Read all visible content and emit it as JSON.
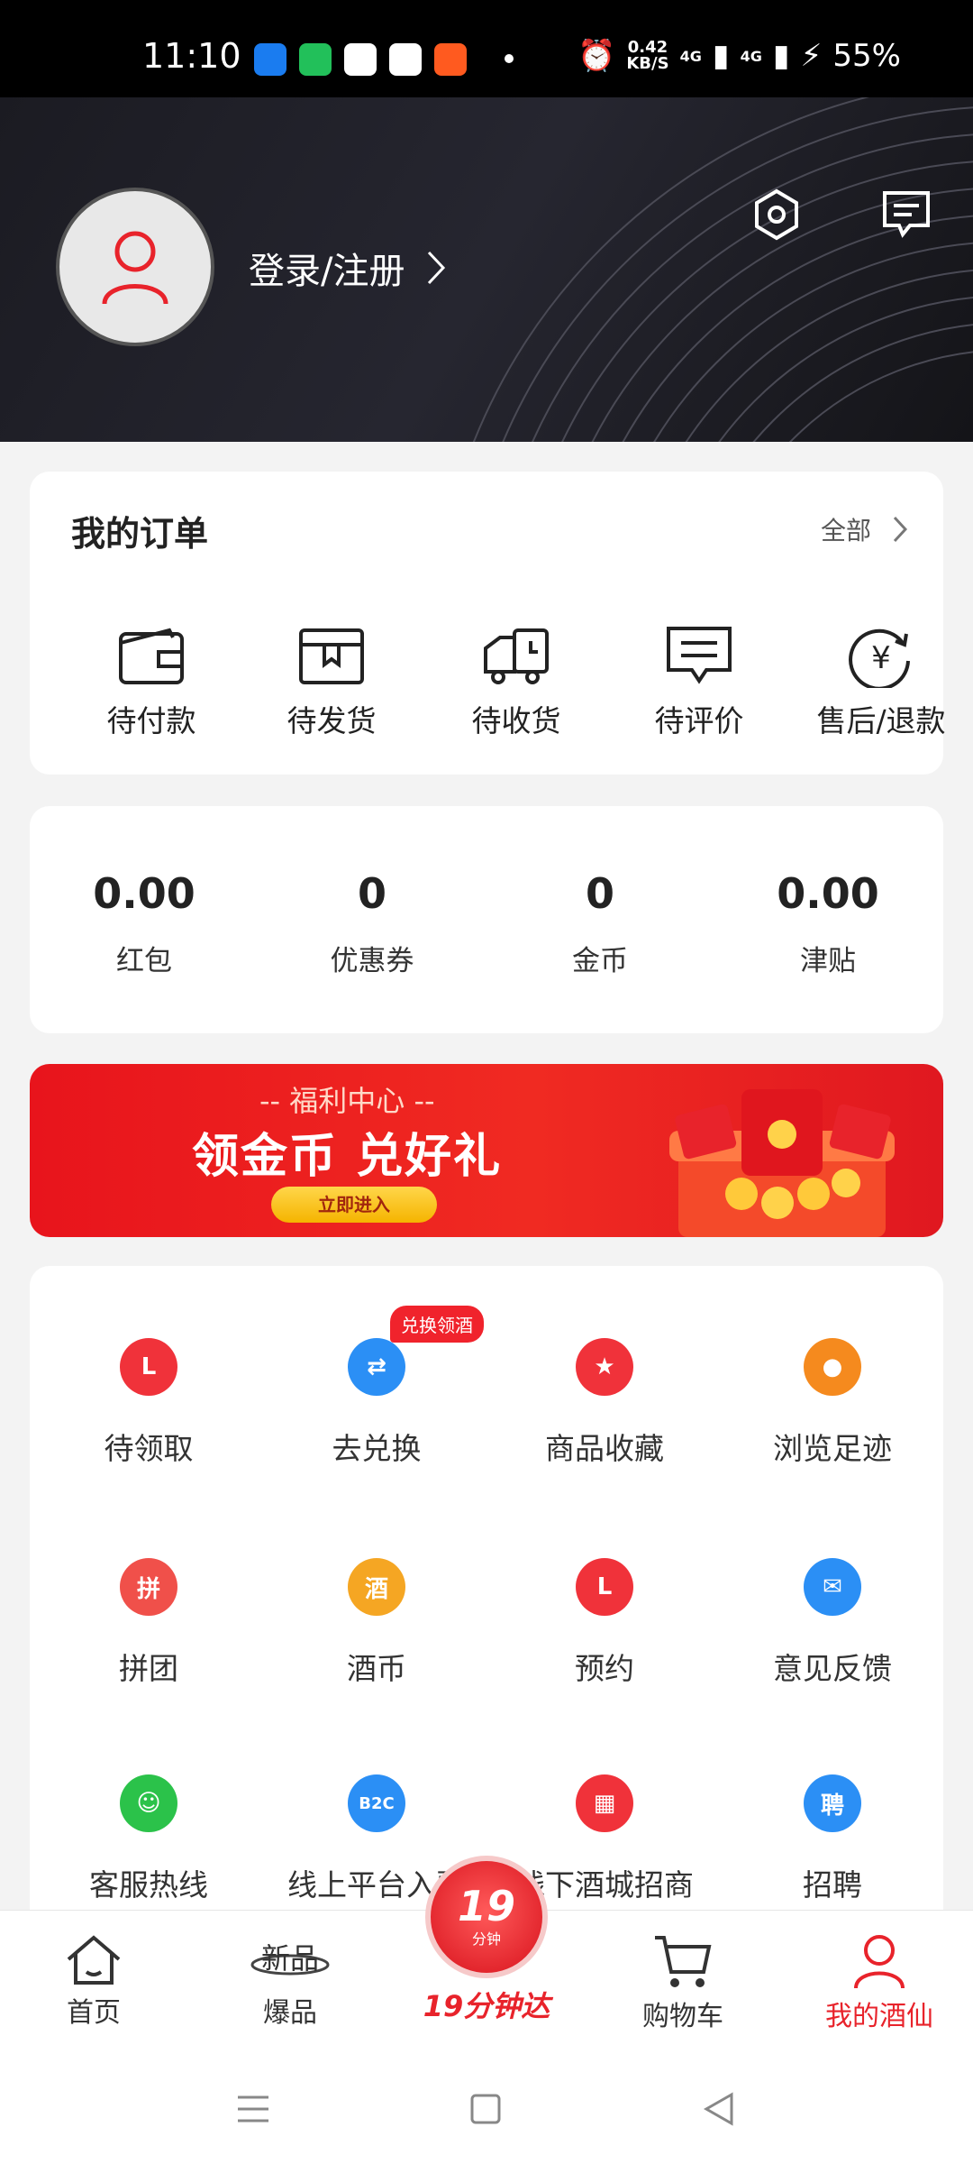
{
  "status_bar": {
    "time": "11:10",
    "speed_value": "0.42",
    "speed_unit": "KB/S",
    "net1": "4G",
    "net2": "4G",
    "battery": "55%"
  },
  "header": {
    "login_label": "登录/注册"
  },
  "orders": {
    "title": "我的订单",
    "all_label": "全部",
    "items": [
      {
        "label": "待付款",
        "icon": "wallet-icon"
      },
      {
        "label": "待发货",
        "icon": "box-icon"
      },
      {
        "label": "待收货",
        "icon": "truck-icon"
      },
      {
        "label": "待评价",
        "icon": "comment-icon"
      },
      {
        "label": "售后/退款",
        "icon": "refund-icon"
      }
    ]
  },
  "wallet": {
    "items": [
      {
        "value": "0.00",
        "label": "红包"
      },
      {
        "value": "0",
        "label": "优惠券"
      },
      {
        "value": "0",
        "label": "金币"
      },
      {
        "value": "0.00",
        "label": "津贴"
      }
    ]
  },
  "banner": {
    "subtitle": "-- 福利中心 --",
    "title": "领金币 兑好礼",
    "button": "立即进入"
  },
  "tools": {
    "badge": "兑换领酒",
    "items": [
      {
        "label": "待领取",
        "icon": "gift-box-icon",
        "glyph": "L",
        "color": "#f0323a"
      },
      {
        "label": "去兑换",
        "icon": "exchange-icon",
        "glyph": "⇄",
        "color": "#2b8ff5"
      },
      {
        "label": "商品收藏",
        "icon": "star-icon",
        "glyph": "★",
        "color": "#f0323a"
      },
      {
        "label": "浏览足迹",
        "icon": "footprint-icon",
        "glyph": "●",
        "color": "#f58a1e"
      },
      {
        "label": "拼团",
        "icon": "group-buy-icon",
        "glyph": "拼",
        "color": "#f0504a"
      },
      {
        "label": "酒币",
        "icon": "wine-coin-icon",
        "glyph": "酒",
        "color": "#f5a623"
      },
      {
        "label": "预约",
        "icon": "clock-icon",
        "glyph": "L",
        "color": "#f0323a"
      },
      {
        "label": "意见反馈",
        "icon": "mail-icon",
        "glyph": "✉",
        "color": "#2b8ff5"
      },
      {
        "label": "客服热线",
        "icon": "headset-icon",
        "glyph": "☺",
        "color": "#2bc24a"
      },
      {
        "label": "线上平台入驻",
        "icon": "b2c-icon",
        "glyph": "B2C",
        "color": "#2b8ff5"
      },
      {
        "label": "线下酒城招商",
        "icon": "store-icon",
        "glyph": "▦",
        "color": "#f0323a"
      },
      {
        "label": "招聘",
        "icon": "recruit-icon",
        "glyph": "聘",
        "color": "#2b8ff5"
      }
    ]
  },
  "tabbar": {
    "home": "首页",
    "hot": "爆品",
    "fast_number": "19",
    "fast_unit": "分钟",
    "fast": "19分钟达",
    "cart": "购物车",
    "mine": "我的酒仙"
  },
  "colors": {
    "accent": "#e8232b",
    "header_bg": "#1f1f27"
  }
}
